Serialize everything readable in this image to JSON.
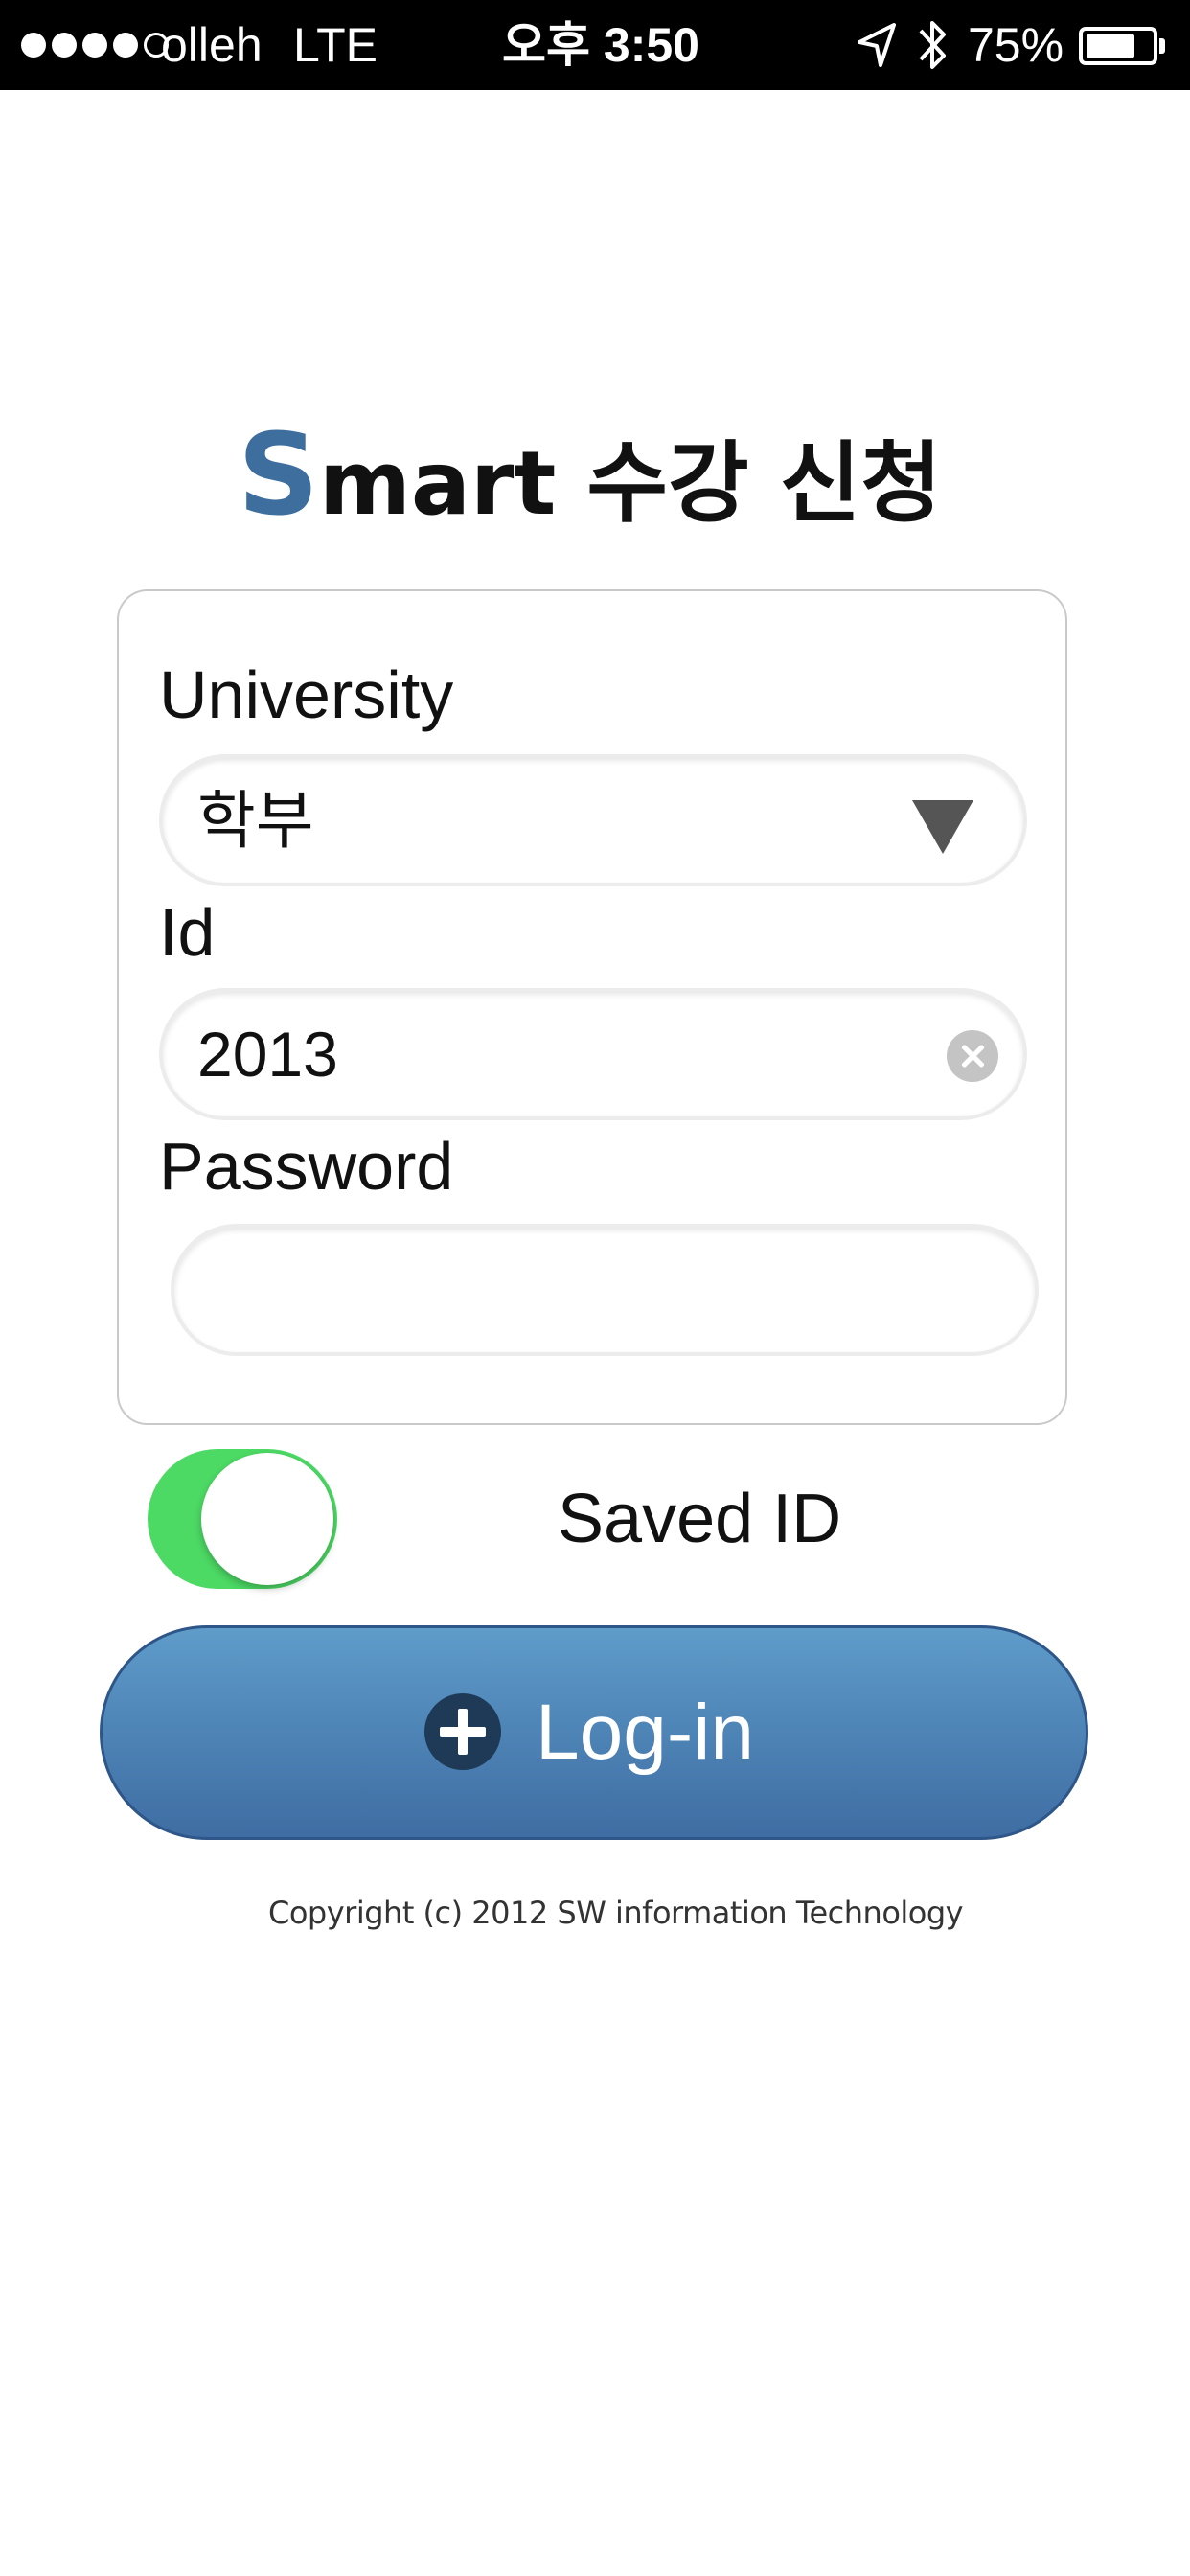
{
  "status_bar": {
    "signal_bars_filled": 4,
    "signal_bars_total": 5,
    "carrier": "olleh",
    "network": "LTE",
    "time": "오후 3:50",
    "location_icon": "location-arrow-icon",
    "bluetooth_icon": "bluetooth-icon",
    "battery_percent": "75%",
    "battery_level": 0.75
  },
  "app": {
    "title_first_letter": "S",
    "title_rest": "mart 수강 신청"
  },
  "form": {
    "university": {
      "label": "University",
      "selected_value": "학부",
      "icon": "dropdown-arrow-icon"
    },
    "id": {
      "label": "Id",
      "value": "2013",
      "icon": "clear-icon"
    },
    "password": {
      "label": "Password",
      "value": ""
    },
    "saved_id": {
      "label": "Saved ID",
      "on": true
    },
    "login_button": {
      "label": "Log-in",
      "icon": "plus-circle-icon"
    }
  },
  "footer": {
    "copyright": "Copyright (c) 2012 SW information Technology"
  },
  "colors": {
    "status_bar_bg": "#000000",
    "title_accent": "#3e6e9e",
    "toggle_on": "#4cd964",
    "button_top": "#5f9cca",
    "button_bottom": "#3f6da3"
  }
}
